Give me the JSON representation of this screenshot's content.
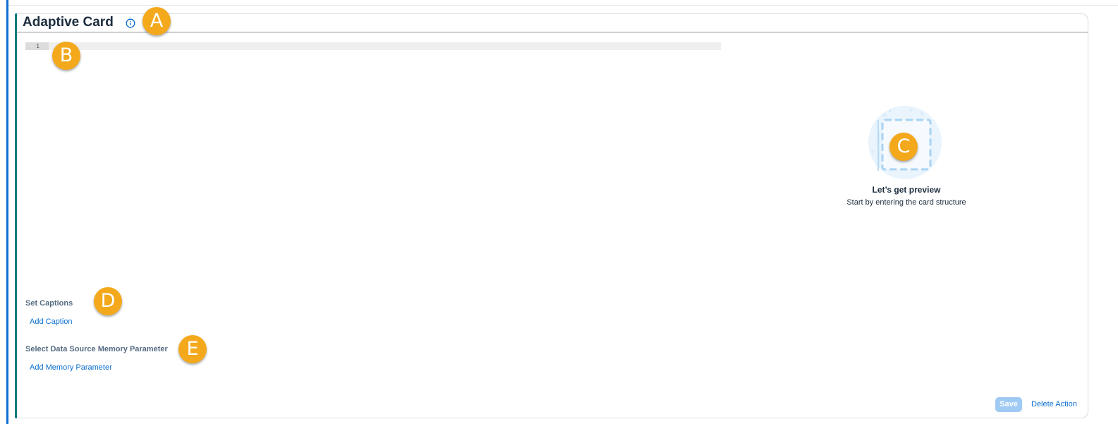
{
  "card": {
    "title": "Adaptive Card",
    "info_icon": "info-circle-icon"
  },
  "editor": {
    "line_number": "1",
    "content": ""
  },
  "preview": {
    "illustration_icon": "card-placeholder-illustration",
    "title": "Let’s get preview",
    "subtitle": "Start by entering the card structure"
  },
  "captions": {
    "label": "Set Captions",
    "add_link": "Add Caption"
  },
  "memory": {
    "label": "Select Data Source Memory Parameter",
    "add_link": "Add Memory Parameter"
  },
  "actions": {
    "save_label": "Save",
    "delete_label": "Delete Action"
  },
  "markers": {
    "a": "A",
    "b": "B",
    "c": "C",
    "d": "D",
    "e": "E"
  },
  "colors": {
    "accent_blue": "#0a6ed1",
    "marker_orange": "#f3a91b",
    "card_accent_teal": "#0f7c7b",
    "disabled_save": "#9fcaf3"
  }
}
